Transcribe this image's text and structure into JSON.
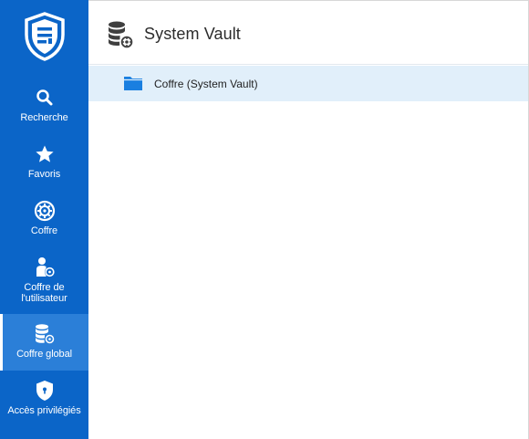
{
  "sidebar": {
    "logo_icon": "shield-logo-icon",
    "items": [
      {
        "label": "Recherche",
        "icon": "search-icon"
      },
      {
        "label": "Favoris",
        "icon": "star-icon"
      },
      {
        "label": "Coffre",
        "icon": "vault-wheel-icon"
      },
      {
        "label": "Coffre de\nl'utilisateur",
        "label_line1": "Coffre de",
        "label_line2": "l'utilisateur",
        "icon": "user-vault-icon"
      },
      {
        "label": "Coffre global",
        "icon": "database-gear-icon",
        "active": true
      },
      {
        "label": "Accès privilégiés",
        "icon": "shield-lock-icon"
      }
    ]
  },
  "header": {
    "title": "System Vault",
    "icon": "database-gear-icon"
  },
  "list": {
    "rows": [
      {
        "label": "Coffre (System Vault)",
        "icon": "folder-icon",
        "selected": true
      }
    ]
  },
  "colors": {
    "sidebar_bg": "#0b65c8",
    "sidebar_active": "#2b7fd8",
    "row_selected": "#e1effa",
    "folder": "#1a7fe0"
  }
}
